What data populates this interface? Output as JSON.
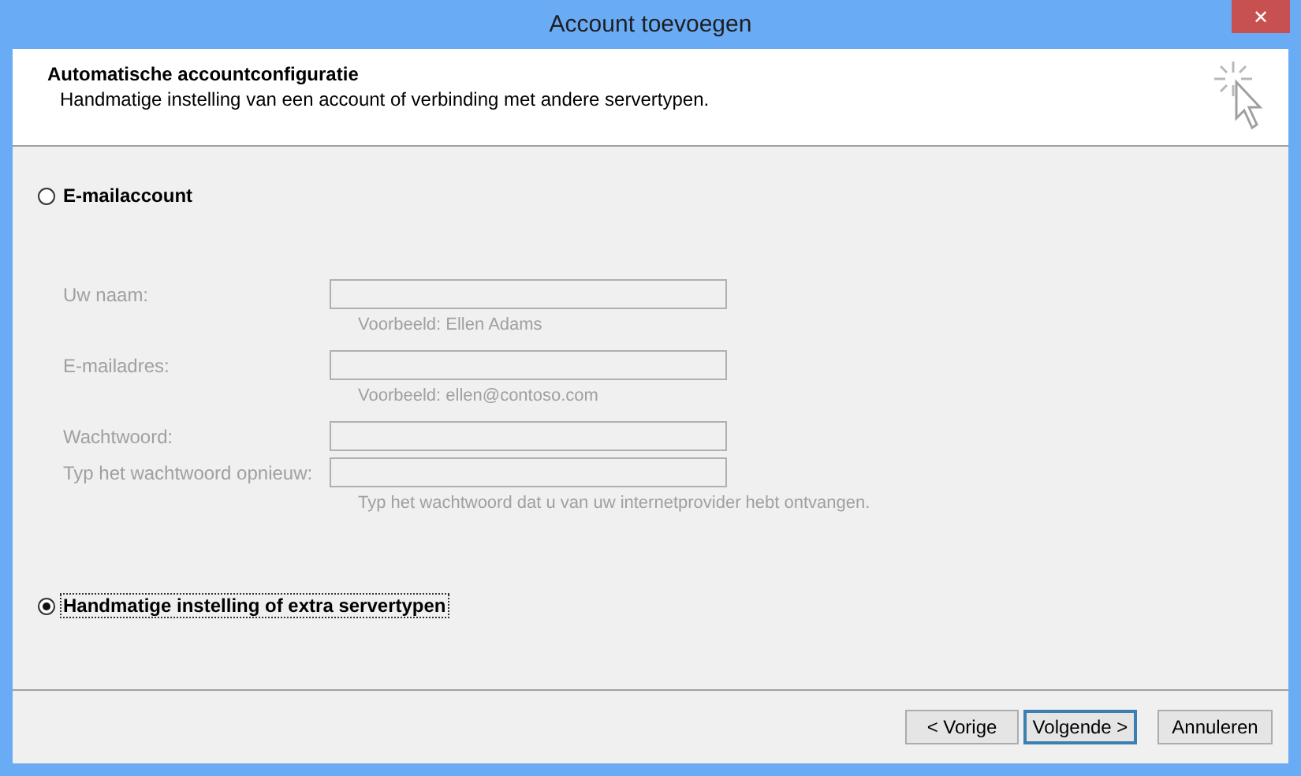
{
  "window": {
    "title": "Account toevoegen",
    "close": "✕"
  },
  "header": {
    "title": "Automatische accountconfiguratie",
    "subtitle": "Handmatige instelling van een account of verbinding met andere servertypen."
  },
  "options": [
    {
      "label": "E-mailaccount",
      "selected": false
    },
    {
      "label": "Handmatige instelling of extra servertypen",
      "selected": true,
      "focused": true
    }
  ],
  "fields": [
    {
      "label": "Uw naam:",
      "hint": "Voorbeeld: Ellen Adams",
      "disabled": true
    },
    {
      "label": "E-mailadres:",
      "hint": "Voorbeeld: ellen@contoso.com",
      "disabled": true
    },
    {
      "label": "Wachtwoord:",
      "disabled": true
    },
    {
      "label": "Typ het wachtwoord opnieuw:",
      "hint": "Typ het wachtwoord dat u van uw internetprovider hebt ontvangen.",
      "disabled": true
    }
  ],
  "buttons": [
    {
      "label": "< Vorige",
      "default": false
    },
    {
      "label": "Volgende >",
      "default": true
    },
    {
      "label": "Annuleren",
      "default": false
    }
  ]
}
